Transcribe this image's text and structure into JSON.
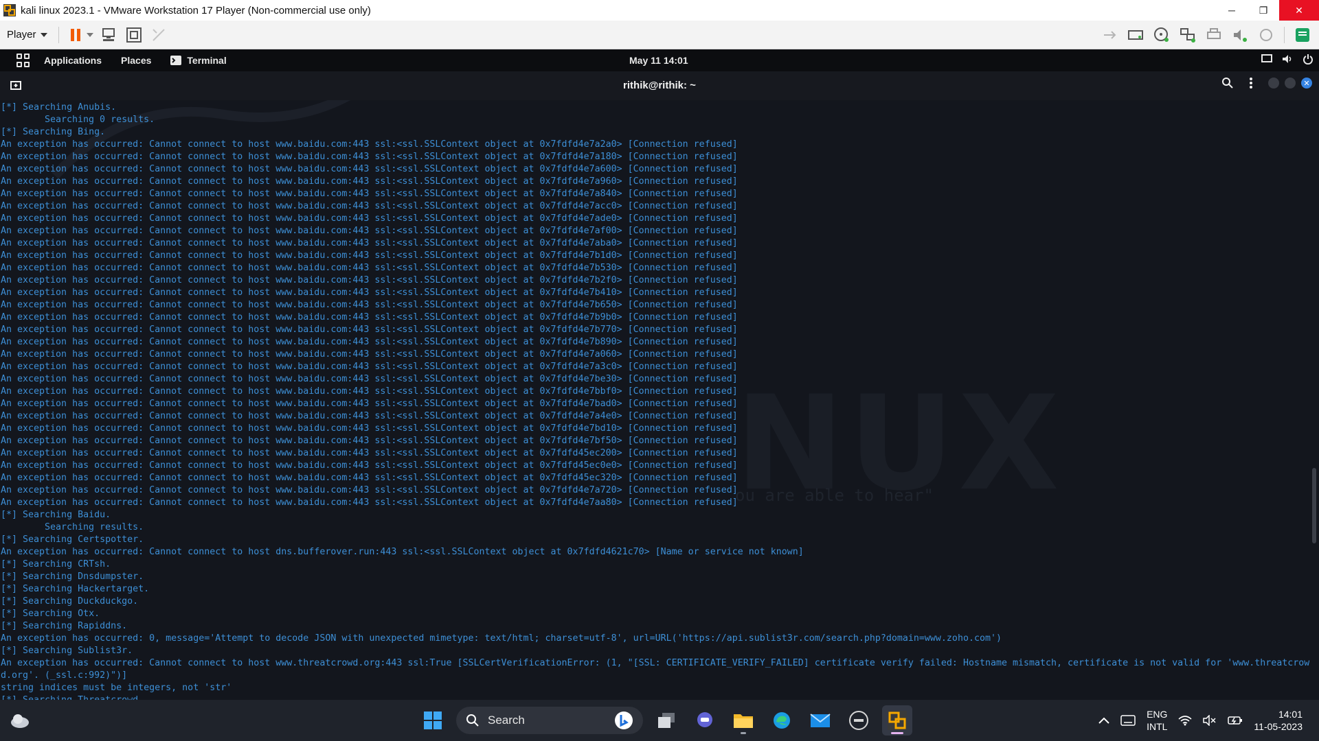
{
  "window": {
    "title": "kali linux 2023.1 - VMware Workstation 17 Player (Non-commercial use only)",
    "minimize_glyph": "─",
    "restore_glyph": "❐",
    "close_glyph": "✕"
  },
  "vm_toolbar": {
    "player_label": "Player",
    "accent_color": "#f25c05"
  },
  "kali_panel": {
    "applications_label": "Applications",
    "places_label": "Places",
    "terminal_label": "Terminal",
    "clock": "May 11  14:01"
  },
  "terminal": {
    "title": "rithik@rithik: ~",
    "lines": [
      "[*] Searching Anubis.",
      "Searching 0 results.",
      "[*] Searching Bing.",
      "An exception has occurred: Cannot connect to host www.baidu.com:443 ssl:<ssl.SSLContext object at 0x7fdfd4e7a2a0> [Connection refused]",
      "An exception has occurred: Cannot connect to host www.baidu.com:443 ssl:<ssl.SSLContext object at 0x7fdfd4e7a180> [Connection refused]",
      "An exception has occurred: Cannot connect to host www.baidu.com:443 ssl:<ssl.SSLContext object at 0x7fdfd4e7a600> [Connection refused]",
      "An exception has occurred: Cannot connect to host www.baidu.com:443 ssl:<ssl.SSLContext object at 0x7fdfd4e7a960> [Connection refused]",
      "An exception has occurred: Cannot connect to host www.baidu.com:443 ssl:<ssl.SSLContext object at 0x7fdfd4e7a840> [Connection refused]",
      "An exception has occurred: Cannot connect to host www.baidu.com:443 ssl:<ssl.SSLContext object at 0x7fdfd4e7acc0> [Connection refused]",
      "An exception has occurred: Cannot connect to host www.baidu.com:443 ssl:<ssl.SSLContext object at 0x7fdfd4e7ade0> [Connection refused]",
      "An exception has occurred: Cannot connect to host www.baidu.com:443 ssl:<ssl.SSLContext object at 0x7fdfd4e7af00> [Connection refused]",
      "An exception has occurred: Cannot connect to host www.baidu.com:443 ssl:<ssl.SSLContext object at 0x7fdfd4e7aba0> [Connection refused]",
      "An exception has occurred: Cannot connect to host www.baidu.com:443 ssl:<ssl.SSLContext object at 0x7fdfd4e7b1d0> [Connection refused]",
      "An exception has occurred: Cannot connect to host www.baidu.com:443 ssl:<ssl.SSLContext object at 0x7fdfd4e7b530> [Connection refused]",
      "An exception has occurred: Cannot connect to host www.baidu.com:443 ssl:<ssl.SSLContext object at 0x7fdfd4e7b2f0> [Connection refused]",
      "An exception has occurred: Cannot connect to host www.baidu.com:443 ssl:<ssl.SSLContext object at 0x7fdfd4e7b410> [Connection refused]",
      "An exception has occurred: Cannot connect to host www.baidu.com:443 ssl:<ssl.SSLContext object at 0x7fdfd4e7b650> [Connection refused]",
      "An exception has occurred: Cannot connect to host www.baidu.com:443 ssl:<ssl.SSLContext object at 0x7fdfd4e7b9b0> [Connection refused]",
      "An exception has occurred: Cannot connect to host www.baidu.com:443 ssl:<ssl.SSLContext object at 0x7fdfd4e7b770> [Connection refused]",
      "An exception has occurred: Cannot connect to host www.baidu.com:443 ssl:<ssl.SSLContext object at 0x7fdfd4e7b890> [Connection refused]",
      "An exception has occurred: Cannot connect to host www.baidu.com:443 ssl:<ssl.SSLContext object at 0x7fdfd4e7a060> [Connection refused]",
      "An exception has occurred: Cannot connect to host www.baidu.com:443 ssl:<ssl.SSLContext object at 0x7fdfd4e7a3c0> [Connection refused]",
      "An exception has occurred: Cannot connect to host www.baidu.com:443 ssl:<ssl.SSLContext object at 0x7fdfd4e7be30> [Connection refused]",
      "An exception has occurred: Cannot connect to host www.baidu.com:443 ssl:<ssl.SSLContext object at 0x7fdfd4e7bbf0> [Connection refused]",
      "An exception has occurred: Cannot connect to host www.baidu.com:443 ssl:<ssl.SSLContext object at 0x7fdfd4e7bad0> [Connection refused]",
      "An exception has occurred: Cannot connect to host www.baidu.com:443 ssl:<ssl.SSLContext object at 0x7fdfd4e7a4e0> [Connection refused]",
      "An exception has occurred: Cannot connect to host www.baidu.com:443 ssl:<ssl.SSLContext object at 0x7fdfd4e7bd10> [Connection refused]",
      "An exception has occurred: Cannot connect to host www.baidu.com:443 ssl:<ssl.SSLContext object at 0x7fdfd4e7bf50> [Connection refused]",
      "An exception has occurred: Cannot connect to host www.baidu.com:443 ssl:<ssl.SSLContext object at 0x7fdfd45ec200> [Connection refused]",
      "An exception has occurred: Cannot connect to host www.baidu.com:443 ssl:<ssl.SSLContext object at 0x7fdfd45ec0e0> [Connection refused]",
      "An exception has occurred: Cannot connect to host www.baidu.com:443 ssl:<ssl.SSLContext object at 0x7fdfd45ec320> [Connection refused]",
      "An exception has occurred: Cannot connect to host www.baidu.com:443 ssl:<ssl.SSLContext object at 0x7fdfd4e7a720> [Connection refused]",
      "An exception has occurred: Cannot connect to host www.baidu.com:443 ssl:<ssl.SSLContext object at 0x7fdfd4e7aa80> [Connection refused]",
      "[*] Searching Baidu.",
      "Searching results.",
      "[*] Searching Certspotter.",
      "An exception has occurred: Cannot connect to host dns.bufferover.run:443 ssl:<ssl.SSLContext object at 0x7fdfd4621c70> [Name or service not known]",
      "[*] Searching CRTsh.",
      "[*] Searching Dnsdumpster.",
      "[*] Searching Hackertarget.",
      "[*] Searching Duckduckgo.",
      "[*] Searching Otx.",
      "[*] Searching Rapiddns.",
      "An exception has occurred: 0, message='Attempt to decode JSON with unexpected mimetype: text/html; charset=utf-8', url=URL('https://api.sublist3r.com/search.php?domain=www.zoho.com')",
      "[*] Searching Sublist3r.",
      "An exception has occurred: Cannot connect to host www.threatcrowd.org:443 ssl:True [SSLCertVerificationError: (1, \"[SSL: CERTIFICATE_VERIFY_FAILED] certificate verify failed: Hostname mismatch, certificate is not valid for 'www.threatcrow",
      "d.org'. (_ssl.c:992)\")]",
      "string indices must be integers, not 'str'",
      "[*] Searching Threatcrowd."
    ],
    "indented_line_indexes": [
      1,
      34
    ],
    "watermark_text": "NUX",
    "watermark_sub": "ou are able to hear\"",
    "text_color": "#3d8fd6"
  },
  "taskbar": {
    "search_placeholder": "Search",
    "apps": [
      "start-icon",
      "search",
      "task-view-icon",
      "teams-chat-icon",
      "file-explorer-icon",
      "edge-icon",
      "mail-icon",
      "dell-icon",
      "vmware-icon"
    ],
    "lang_top": "ENG",
    "lang_bottom": "INTL",
    "time": "14:01",
    "date": "11-05-2023"
  }
}
